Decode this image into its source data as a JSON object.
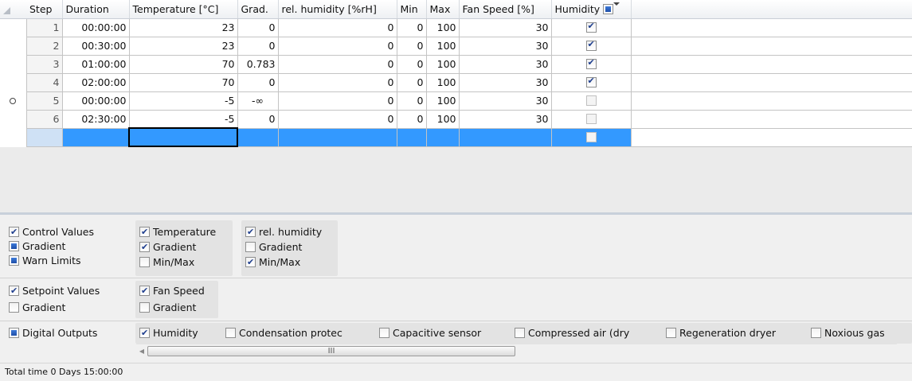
{
  "grid": {
    "columns": [
      "Step",
      "Duration",
      "Temperature [°C]",
      "Grad.",
      "rel. humidity [%rH]",
      "Min",
      "Max",
      "Fan Speed [%]",
      "Humidity"
    ],
    "humidity_header_state": "indeterminate",
    "rows": [
      {
        "step": "1",
        "duration": "00:00:00",
        "temperature": "23",
        "grad": "0",
        "rel_humidity": "0",
        "min": "0",
        "max": "100",
        "fan_speed": "30",
        "humidity": true,
        "marker": false
      },
      {
        "step": "2",
        "duration": "00:30:00",
        "temperature": "23",
        "grad": "0",
        "rel_humidity": "0",
        "min": "0",
        "max": "100",
        "fan_speed": "30",
        "humidity": true,
        "marker": false
      },
      {
        "step": "3",
        "duration": "01:00:00",
        "temperature": "70",
        "grad": "0.783",
        "rel_humidity": "0",
        "min": "0",
        "max": "100",
        "fan_speed": "30",
        "humidity": true,
        "marker": false
      },
      {
        "step": "4",
        "duration": "02:00:00",
        "temperature": "70",
        "grad": "0",
        "rel_humidity": "0",
        "min": "0",
        "max": "100",
        "fan_speed": "30",
        "humidity": true,
        "marker": false
      },
      {
        "step": "5",
        "duration": "00:00:00",
        "temperature": "-5",
        "grad": "-∞",
        "rel_humidity": "0",
        "min": "0",
        "max": "100",
        "fan_speed": "30",
        "humidity": false,
        "marker": true
      },
      {
        "step": "6",
        "duration": "02:30:00",
        "temperature": "-5",
        "grad": "0",
        "rel_humidity": "0",
        "min": "0",
        "max": "100",
        "fan_speed": "30",
        "humidity": false,
        "marker": false
      }
    ]
  },
  "options": {
    "control_values": {
      "label": "Control Values",
      "checked": true
    },
    "control_gradient": {
      "label": "Gradient",
      "state": "indeterminate"
    },
    "warn_limits": {
      "label": "Warn Limits",
      "state": "indeterminate"
    },
    "temperature": {
      "label": "Temperature",
      "checked": true
    },
    "temperature_gradient": {
      "label": "Gradient",
      "checked": true
    },
    "temperature_minmax": {
      "label": "Min/Max",
      "checked": false
    },
    "rel_humidity": {
      "label": "rel. humidity",
      "checked": true
    },
    "rel_humidity_gradient": {
      "label": "Gradient",
      "checked": false
    },
    "rel_humidity_minmax": {
      "label": "Min/Max",
      "checked": true
    },
    "setpoint_values": {
      "label": "Setpoint Values",
      "checked": true
    },
    "setpoint_gradient": {
      "label": "Gradient",
      "checked": false
    },
    "fan_speed": {
      "label": "Fan Speed",
      "checked": true
    },
    "fan_speed_gradient": {
      "label": "Gradient",
      "checked": false
    }
  },
  "digital_outputs": {
    "label": "Digital Outputs",
    "state": "indeterminate",
    "items": [
      {
        "label": "Humidity",
        "checked": true
      },
      {
        "label": "Condensation protec",
        "checked": false
      },
      {
        "label": "Capacitive sensor",
        "checked": false
      },
      {
        "label": "Compressed air (dry",
        "checked": false
      },
      {
        "label": "Regeneration dryer",
        "checked": false
      },
      {
        "label": "Noxious gas",
        "checked": false
      }
    ]
  },
  "scrollbar": {
    "thumb_grip": "III"
  },
  "status": {
    "total_time": "Total time 0 Days 15:00:00"
  }
}
